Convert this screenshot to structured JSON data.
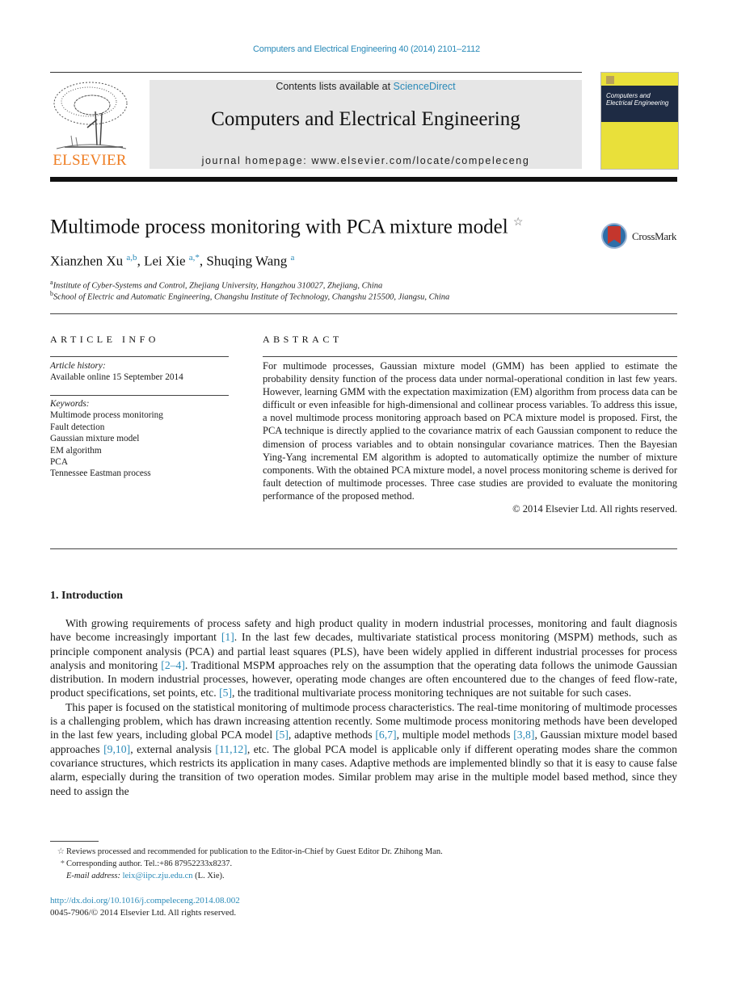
{
  "running_header": "Computers and Electrical Engineering 40 (2014) 2101–2112",
  "masthead": {
    "publisher_logo_text": "ELSEVIER",
    "contents_prefix": "Contents lists available at ",
    "contents_link": "ScienceDirect",
    "journal_title": "Computers and Electrical Engineering",
    "homepage": "journal homepage: www.elsevier.com/locate/compeleceng",
    "cover_title_line1": "Computers and",
    "cover_title_line2": "Electrical Engineering"
  },
  "article": {
    "title": "Multimode process monitoring with PCA mixture model",
    "title_note_mark": "☆",
    "crossmark_label": "CrossMark",
    "authors": [
      {
        "name": "Xianzhen Xu",
        "sup": "a,b",
        "sep": ", "
      },
      {
        "name": "Lei Xie",
        "sup": "a,*",
        "sep": ", "
      },
      {
        "name": "Shuqing Wang",
        "sup": "a",
        "sep": ""
      }
    ],
    "affiliations": [
      {
        "mark": "a",
        "text": "Institute of Cyber-Systems and Control, Zhejiang University, Hangzhou 310027, Zhejiang, China"
      },
      {
        "mark": "b",
        "text": "School of Electric and Automatic Engineering, Changshu Institute of Technology, Changshu 215500, Jiangsu, China"
      }
    ]
  },
  "article_info": {
    "heading": "ARTICLE INFO",
    "history_label": "Article history:",
    "history_value": "Available online 15 September 2014",
    "keywords_label": "Keywords:",
    "keywords": [
      "Multimode process monitoring",
      "Fault detection",
      "Gaussian mixture model",
      "EM algorithm",
      "PCA",
      "Tennessee Eastman process"
    ]
  },
  "abstract": {
    "heading": "ABSTRACT",
    "text": "For multimode processes, Gaussian mixture model (GMM) has been applied to estimate the probability density function of the process data under normal-operational condition in last few years. However, learning GMM with the expectation maximization (EM) algorithm from process data can be difficult or even infeasible for high-dimensional and collinear process variables. To address this issue, a novel multimode process monitoring approach based on PCA mixture model is proposed. First, the PCA technique is directly applied to the covariance matrix of each Gaussian component to reduce the dimension of process variables and to obtain nonsingular covariance matrices. Then the Bayesian Ying-Yang incremental EM algorithm is adopted to automatically optimize the number of mixture components. With the obtained PCA mixture model, a novel process monitoring scheme is derived for fault detection of multimode processes. Three case studies are provided to evaluate the monitoring performance of the proposed method.",
    "copyright": "© 2014 Elsevier Ltd. All rights reserved."
  },
  "introduction": {
    "heading": "1. Introduction",
    "p1": [
      {
        "t": "With growing requirements of process safety and high product quality in modern industrial processes, monitoring and fault diagnosis have become increasingly important "
      },
      {
        "ref": "[1]"
      },
      {
        "t": ". In the last few decades, multivariate statistical process monitoring (MSPM) methods, such as principle component analysis (PCA) and partial least squares (PLS), have been widely applied in different industrial processes for process analysis and monitoring "
      },
      {
        "ref": "[2–4]"
      },
      {
        "t": ". Traditional MSPM approaches rely on the assumption that the operating data follows the unimode Gaussian distribution. In modern industrial processes, however, operating mode changes are often encountered due to the changes of feed flow-rate, product specifications, set points, etc. "
      },
      {
        "ref": "[5]"
      },
      {
        "t": ", the traditional multivariate process monitoring techniques are not suitable for such cases."
      }
    ],
    "p2": [
      {
        "t": "This paper is focused on the statistical monitoring of multimode process characteristics. The real-time monitoring of multimode processes is a challenging problem, which has drawn increasing attention recently. Some multimode process monitoring methods have been developed in the last few years, including global PCA model "
      },
      {
        "ref": "[5]"
      },
      {
        "t": ", adaptive methods "
      },
      {
        "ref": "[6,7]"
      },
      {
        "t": ", multiple model methods "
      },
      {
        "ref": "[3,8]"
      },
      {
        "t": ", Gaussian mixture model based approaches "
      },
      {
        "ref": "[9,10]"
      },
      {
        "t": ", external analysis "
      },
      {
        "ref": "[11,12]"
      },
      {
        "t": ", etc. The global PCA model is applicable only if different operating modes share the common covariance structures, which restricts its application in many cases. Adaptive methods are implemented blindly so that it is easy to cause false alarm, especially during the transition of two operation modes. Similar problem may arise in the multiple model based method, since they need to assign the"
      }
    ]
  },
  "footnotes": {
    "note1_mark": "☆",
    "note1": "Reviews processed and recommended for publication to the Editor-in-Chief by Guest Editor Dr. Zhihong Man.",
    "note2_mark": "*",
    "note2": "Corresponding author. Tel.:+86 87952233x8237.",
    "email_label": "E-mail address:",
    "email": "leix@iipc.zju.edu.cn",
    "email_suffix": " (L. Xie).",
    "doi": "http://dx.doi.org/10.1016/j.compeleceng.2014.08.002",
    "issn_line": "0045-7906/© 2014 Elsevier Ltd. All rights reserved."
  },
  "colors": {
    "link": "#2a8ab8",
    "elsevier_orange": "#ef7d22",
    "masthead_bg": "#e6e6e6",
    "cover_yellow": "#e9e03a"
  }
}
